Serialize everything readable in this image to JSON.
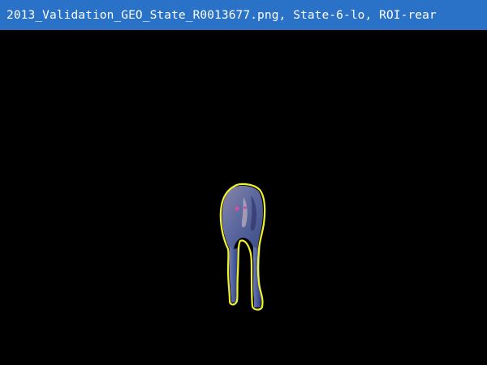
{
  "window": {
    "title": "2013_Validation_GEO_State_R0013677.png, State-6-lo, ROI-rear"
  },
  "image": {
    "subject_icon": "animal-rear-silhouette-icon",
    "roi_outline_color": "#f2f22a",
    "background_color": "#000000"
  },
  "colors": {
    "titlebar": "#2a72c8",
    "title_text": "#ffffff"
  }
}
